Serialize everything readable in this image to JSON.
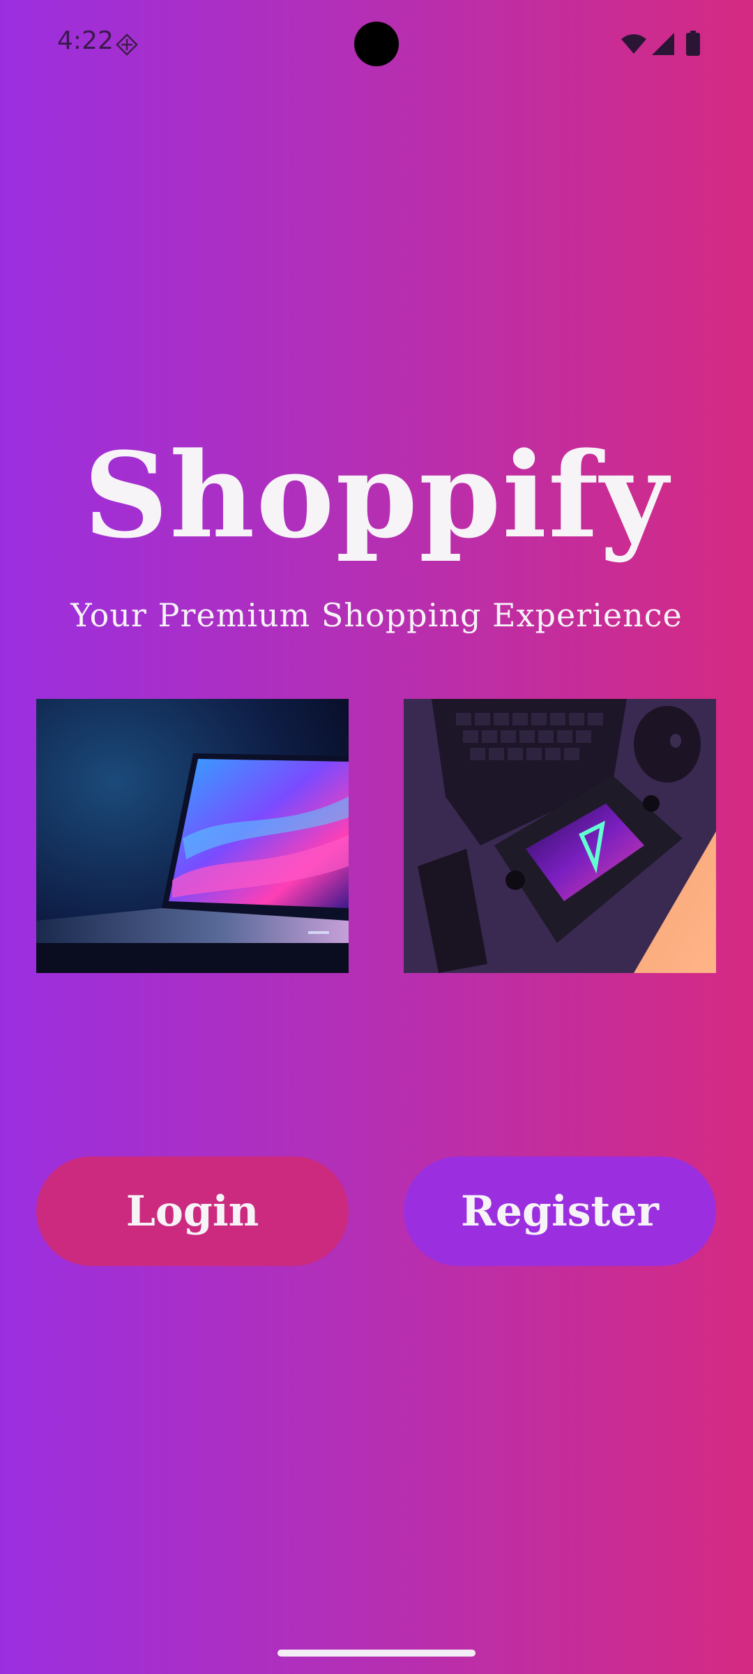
{
  "status_bar": {
    "time": "4:22",
    "icons": [
      "notification-icon",
      "wifi-icon",
      "signal-icon",
      "battery-icon"
    ]
  },
  "branding": {
    "title": "Shoppify",
    "subtitle": "Your Premium Shopping Experience"
  },
  "images": [
    {
      "name": "laptop-image",
      "depicts": "laptop with colorful wave screen"
    },
    {
      "name": "gaming-setup-image",
      "depicts": "keyboard, mouse and handheld gaming console"
    }
  ],
  "buttons": {
    "login_label": "Login",
    "register_label": "Register"
  },
  "colors": {
    "gradient_start": "#9b2fe0",
    "gradient_end": "#d52a82",
    "login_button": "#cc2a7f",
    "register_button": "#9b2fe0",
    "text": "#f7f4f8"
  }
}
